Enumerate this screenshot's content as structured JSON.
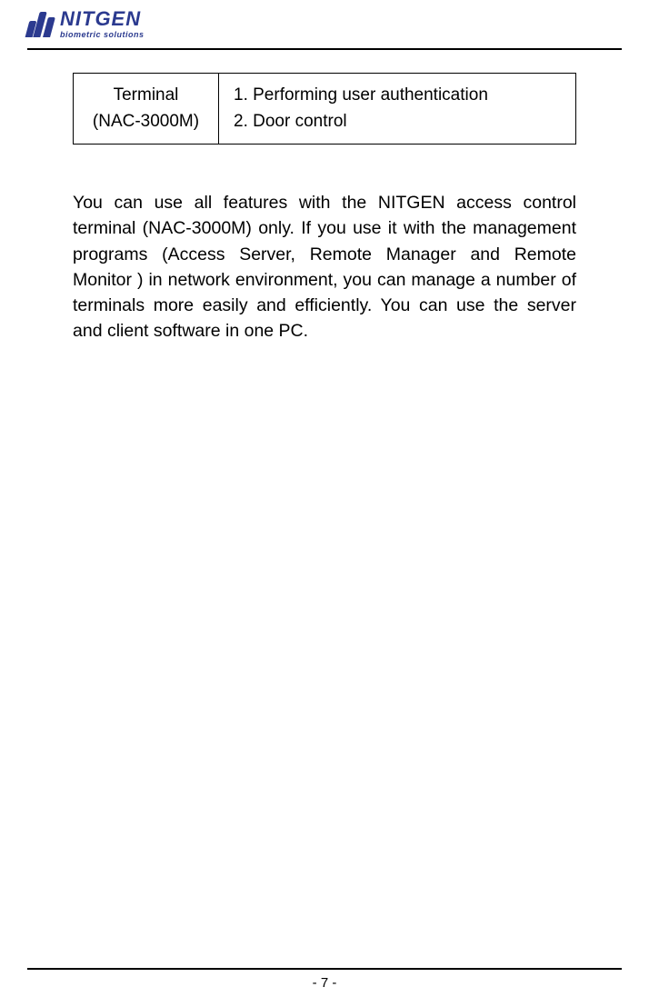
{
  "header": {
    "brand": "NITGEN",
    "tagline": "biometric solutions"
  },
  "table": {
    "label_line1": "Terminal",
    "label_line2": "(NAC-3000M)",
    "items": [
      "Performing user authentication",
      "Door control"
    ]
  },
  "body_paragraph": "You can use all features with the NITGEN access control terminal (NAC-3000M) only. If you use it with the management programs (Access Server, Remote Manager and Remote Monitor ) in network environment, you can manage a number of terminals more easily and efficiently. You can use the server and client software in one PC.",
  "footer": {
    "page_number": "- 7 -"
  }
}
